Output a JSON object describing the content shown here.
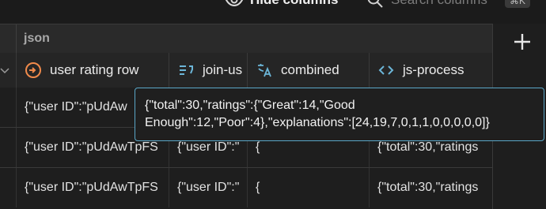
{
  "toolbar": {
    "hide_columns_label": "Hide columns",
    "search_placeholder": "Search columns",
    "shortcut": "⌘K"
  },
  "group_header": {
    "label": "json"
  },
  "columns": [
    {
      "label": "user rating row",
      "icon": "link-circle-icon"
    },
    {
      "label": "join-us",
      "icon": "text-quote-icon"
    },
    {
      "label": "combined",
      "icon": "translate-icon"
    },
    {
      "label": "js-process",
      "icon": "code-icon"
    }
  ],
  "rows": [
    {
      "c0": "",
      "c1": "{\"user ID\":\"pUdAw",
      "c2": "",
      "c3": "",
      "c4": ""
    },
    {
      "c0": "",
      "c1": "{\"user ID\":\"pUdAwTpFS",
      "c2": "{\"user ID\":\"",
      "c3": "{",
      "c4": "{\"total\":30,\"ratings"
    },
    {
      "c0": "",
      "c1": "{\"user ID\":\"pUdAwTpFS",
      "c2": "{\"user ID\":\"",
      "c3": "{",
      "c4": "{\"total\":30,\"ratings"
    }
  ],
  "tooltip": {
    "line1": "{\"total\":30,\"ratings\":{\"Great\":14,\"Good",
    "line2": "Enough\":12,\"Poor\":4},\"explanations\":[24,19,7,0,1,1,0,0,0,0,0]}"
  },
  "colors": {
    "accent_border": "#5aa7c8",
    "icon_orange": "#f08a4b",
    "icon_blue": "#6cb6d8"
  }
}
